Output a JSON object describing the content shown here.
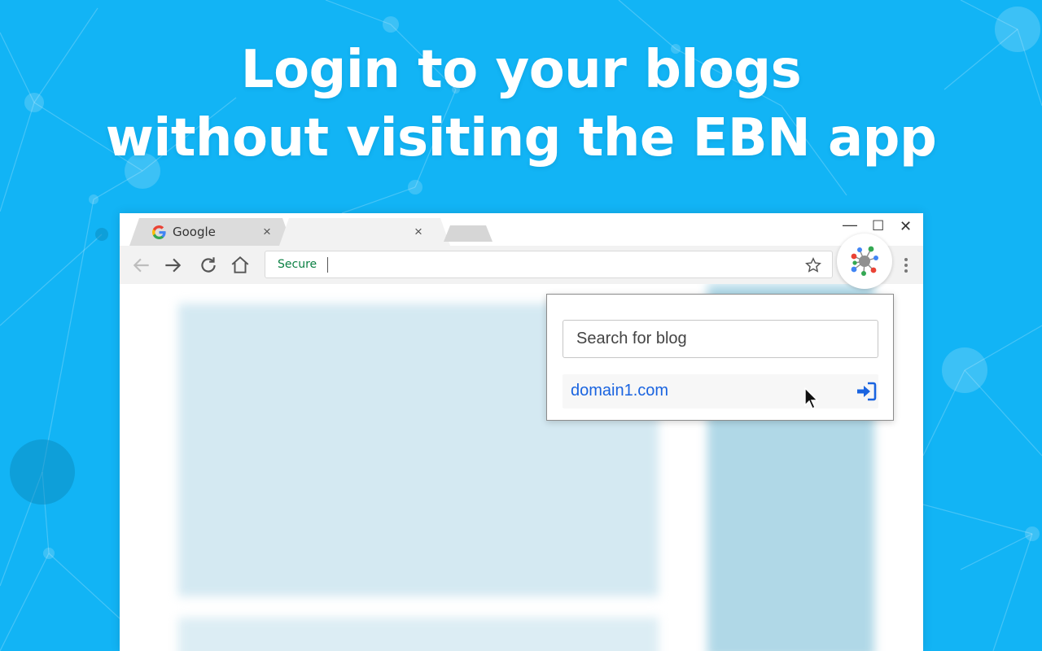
{
  "headline": {
    "line1": "Login to your blogs",
    "line2": "without visiting the EBN app"
  },
  "colors": {
    "background": "#12b4f5",
    "accent_blue": "#1a64e0",
    "secure_green": "#0b8043"
  },
  "browser": {
    "tabs": [
      {
        "title": "Google",
        "icon": "google-g-icon",
        "close": "×"
      },
      {
        "title": "",
        "close": "×"
      }
    ],
    "window_controls": {
      "minimize": "—",
      "maximize": "☐",
      "close": "✕"
    },
    "toolbar": {
      "back_icon": "arrow-left-icon",
      "forward_icon": "arrow-right-icon",
      "reload_icon": "reload-icon",
      "home_icon": "home-icon",
      "secure_label": "Secure",
      "bookmark_icon": "star-icon",
      "menu_icon": "kebab-menu-icon",
      "extension_icon": "ebn-extension-icon"
    }
  },
  "popup": {
    "search": {
      "placeholder": "Search for blog",
      "value": ""
    },
    "blogs": [
      {
        "domain": "domain1.com",
        "action_icon": "sign-in-icon"
      }
    ]
  }
}
